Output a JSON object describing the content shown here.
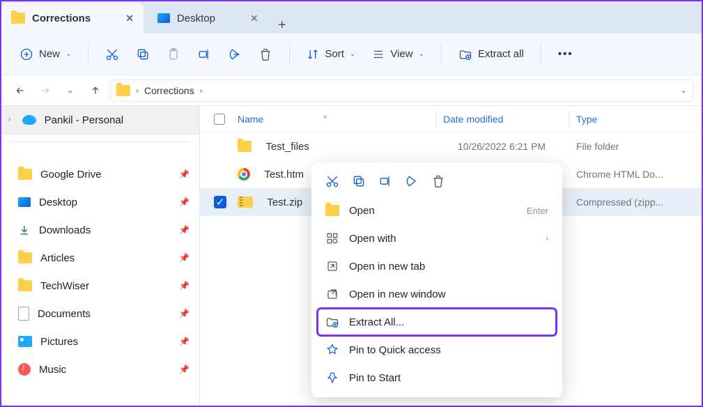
{
  "tabs": [
    {
      "label": "Corrections",
      "active": true
    },
    {
      "label": "Desktop",
      "active": false
    }
  ],
  "toolbar": {
    "new_label": "New",
    "sort_label": "Sort",
    "view_label": "View",
    "extract_all_label": "Extract all"
  },
  "breadcrumb": {
    "segments": [
      "Corrections"
    ]
  },
  "sidebar": {
    "account": "Pankil - Personal",
    "quick": [
      {
        "label": "Google Drive",
        "icon": "folder"
      },
      {
        "label": "Desktop",
        "icon": "desktop"
      },
      {
        "label": "Downloads",
        "icon": "download"
      },
      {
        "label": "Articles",
        "icon": "folder"
      },
      {
        "label": "TechWiser",
        "icon": "folder"
      },
      {
        "label": "Documents",
        "icon": "document"
      },
      {
        "label": "Pictures",
        "icon": "pictures"
      },
      {
        "label": "Music",
        "icon": "music"
      }
    ]
  },
  "columns": {
    "name": "Name",
    "date": "Date modified",
    "type": "Type"
  },
  "rows": [
    {
      "name": "Test_files",
      "date": "10/26/2022 6:21 PM",
      "type": "File folder",
      "icon": "folder",
      "selected": false
    },
    {
      "name": "Test.htm",
      "date": "",
      "type": "Chrome HTML Do...",
      "icon": "chrome",
      "selected": false
    },
    {
      "name": "Test.zip",
      "date": "",
      "type": "Compressed (zipp...",
      "icon": "zip",
      "selected": true
    }
  ],
  "context_menu": {
    "items": [
      {
        "label": "Open",
        "hint": "Enter",
        "icon": "folder-open"
      },
      {
        "label": "Open with",
        "submenu": true,
        "icon": "open-with"
      },
      {
        "label": "Open in new tab",
        "icon": "new-tab"
      },
      {
        "label": "Open in new window",
        "icon": "new-window"
      },
      {
        "label": "Extract All...",
        "icon": "extract",
        "highlight": true
      },
      {
        "label": "Pin to Quick access",
        "icon": "pin"
      },
      {
        "label": "Pin to Start",
        "icon": "pin"
      }
    ]
  }
}
